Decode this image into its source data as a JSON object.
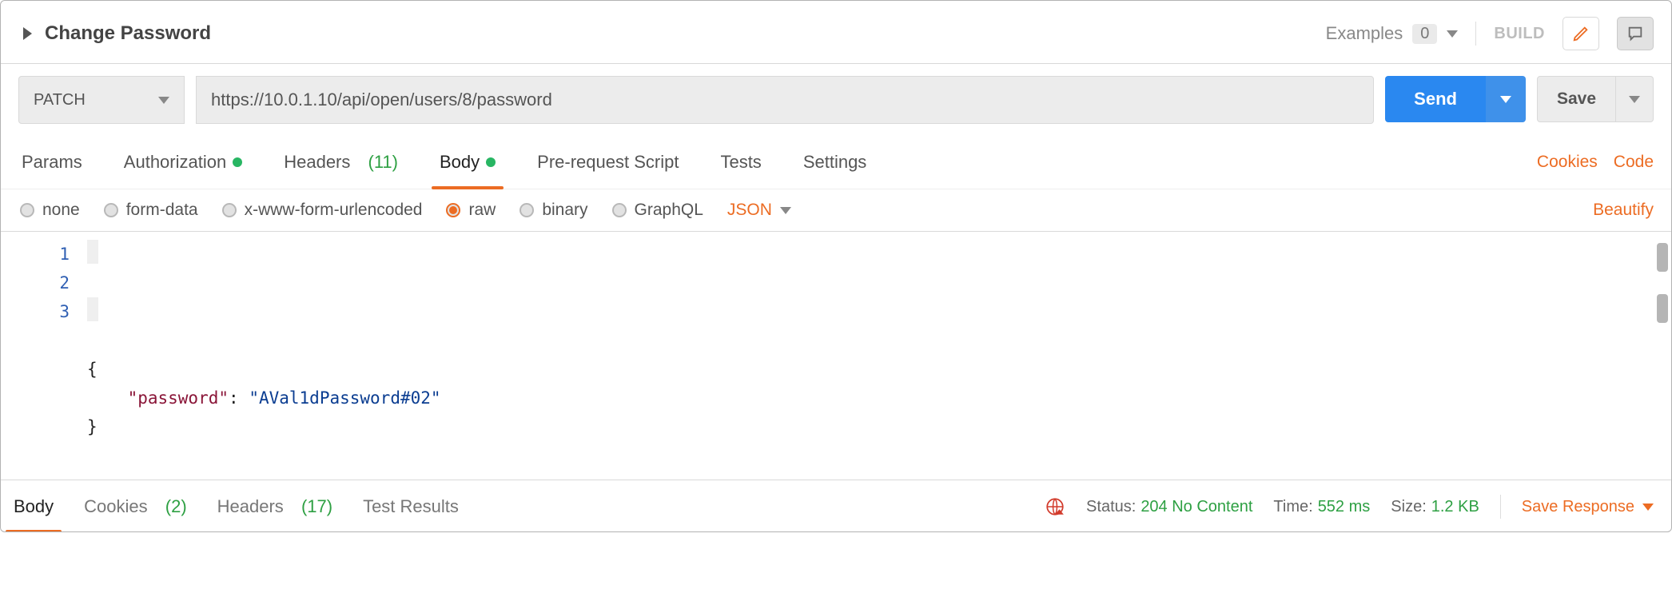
{
  "header": {
    "title": "Change Password",
    "examples_label": "Examples",
    "examples_count": "0",
    "build_label": "BUILD"
  },
  "request": {
    "method": "PATCH",
    "url": "https://10.0.1.10/api/open/users/8/password",
    "send_label": "Send",
    "save_label": "Save"
  },
  "tabs": {
    "params": "Params",
    "authorization": "Authorization",
    "headers": "Headers",
    "headers_count": "(11)",
    "body": "Body",
    "pre_request": "Pre-request Script",
    "tests": "Tests",
    "settings": "Settings",
    "cookies_link": "Cookies",
    "code_link": "Code"
  },
  "body_type": {
    "none": "none",
    "form_data": "form-data",
    "urlencoded": "x-www-form-urlencoded",
    "raw": "raw",
    "binary": "binary",
    "graphql": "GraphQL",
    "format": "JSON",
    "beautify": "Beautify"
  },
  "editor": {
    "line_numbers": [
      "1",
      "2",
      "3"
    ],
    "body_json": {
      "password": "AVal1dPassword#02"
    }
  },
  "response": {
    "tab_body": "Body",
    "tab_cookies": "Cookies",
    "tab_cookies_count": "(2)",
    "tab_headers": "Headers",
    "tab_headers_count": "(17)",
    "tab_test_results": "Test Results",
    "status_label": "Status:",
    "status_value": "204 No Content",
    "time_label": "Time:",
    "time_value": "552 ms",
    "size_label": "Size:",
    "size_value": "1.2 KB",
    "save_response": "Save Response"
  }
}
